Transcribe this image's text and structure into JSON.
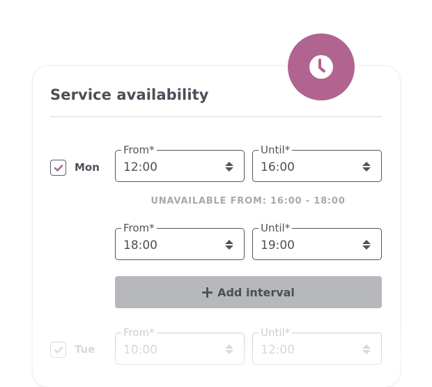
{
  "header": {
    "title": "Service availability",
    "badge_icon": "clock-icon"
  },
  "colors": {
    "accent": "#b0648f",
    "text": "#4a5058",
    "muted": "#a6a9ad",
    "button_bg": "#b6b8bb"
  },
  "days": [
    {
      "label": "Mon",
      "checked": true,
      "intervals": [
        {
          "from_label": "From*",
          "from_value": "12:00",
          "until_label": "Until*",
          "until_value": "16:00"
        },
        {
          "from_label": "From*",
          "from_value": "18:00",
          "until_label": "Until*",
          "until_value": "19:00"
        }
      ],
      "gaps": [
        "UNAVAILABLE FROM: 16:00 - 18:00"
      ],
      "add_interval_label": "Add interval",
      "add_interval_icon": "plus-icon"
    },
    {
      "label": "Tue",
      "checked": true,
      "intervals": [
        {
          "from_label": "From*",
          "from_value": "10:00",
          "until_label": "Until*",
          "until_value": "12:00"
        }
      ]
    }
  ]
}
